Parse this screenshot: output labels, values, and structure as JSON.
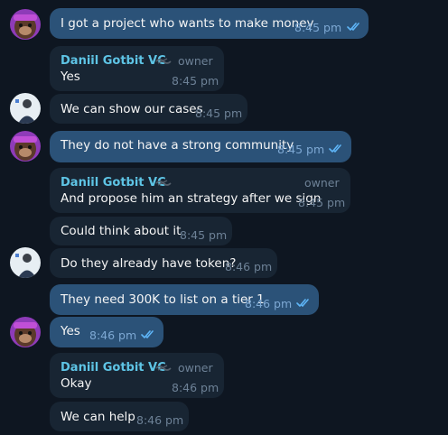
{
  "messages": [
    {
      "text": "I got a project who wants to make money",
      "time": "8:45 pm",
      "read": true
    },
    {
      "sender": "Daniil Gotbit VC",
      "role": "owner",
      "text": "Yes",
      "time": "8:45 pm"
    },
    {
      "text": "We can show our cases",
      "time": "8:45 pm"
    },
    {
      "text": "They do not have a strong community",
      "time": "8:45 pm",
      "read": true
    },
    {
      "sender": "Daniil Gotbit VC",
      "role": "owner",
      "text": "And propose him an strategy after we sign",
      "time": "8:45 pm"
    },
    {
      "text": "Could think about it",
      "time": "8:45 pm"
    },
    {
      "text": "Do they already have token?",
      "time": "8:46 pm"
    },
    {
      "text": "They need 300K to list on a tier 1",
      "time": "8:46 pm",
      "read": true
    },
    {
      "text": "Yes",
      "time": "8:46 pm",
      "read": true
    },
    {
      "sender": "Daniil Gotbit VC",
      "role": "owner",
      "text": "Okay",
      "time": "8:46 pm"
    },
    {
      "text": "We can help",
      "time": "8:46 pm"
    }
  ],
  "colors": {
    "background": "#0e1621",
    "incoming_bubble": "#182533",
    "outgoing_bubble": "#2b5278",
    "sender_name": "#5ec4e5",
    "read_check": "#5eb5f7"
  },
  "icons": {
    "read_receipt": "double-check-icon",
    "admin_badge": "admin-badge-icon"
  }
}
